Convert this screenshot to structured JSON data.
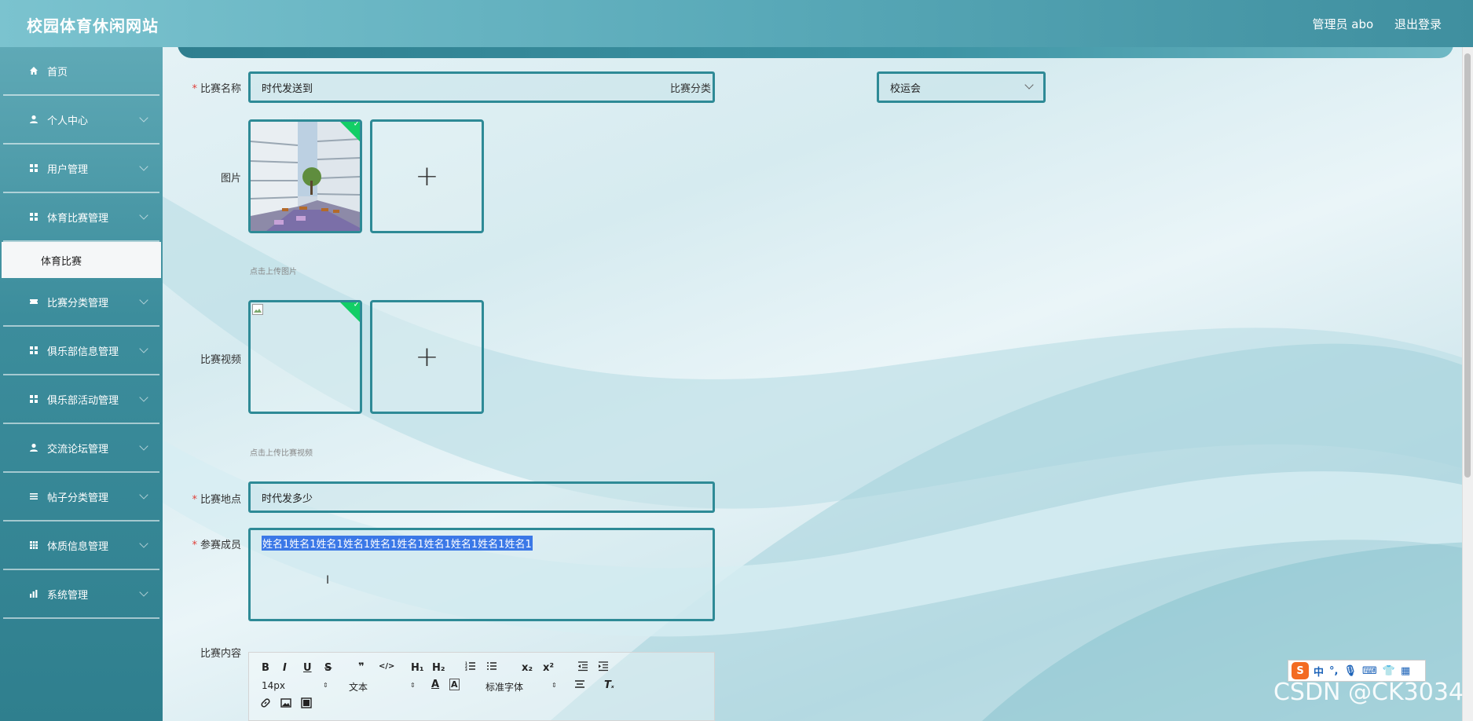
{
  "header": {
    "site_title": "校园体育休闲网站",
    "user_label": "管理员 abo",
    "logout": "退出登录"
  },
  "sidebar": {
    "items": [
      {
        "label": "首页",
        "icon": "home-icon",
        "has_arrow": false
      },
      {
        "label": "个人中心",
        "icon": "user-icon",
        "has_arrow": true
      },
      {
        "label": "用户管理",
        "icon": "grid-icon",
        "has_arrow": true
      },
      {
        "label": "体育比赛管理",
        "icon": "grid-icon",
        "has_arrow": true
      },
      {
        "label": "比赛分类管理",
        "icon": "ticket-icon",
        "has_arrow": true
      },
      {
        "label": "俱乐部信息管理",
        "icon": "grid-icon",
        "has_arrow": true
      },
      {
        "label": "俱乐部活动管理",
        "icon": "grid-icon",
        "has_arrow": true
      },
      {
        "label": "交流论坛管理",
        "icon": "user-icon",
        "has_arrow": true
      },
      {
        "label": "帖子分类管理",
        "icon": "list-icon",
        "has_arrow": true
      },
      {
        "label": "体质信息管理",
        "icon": "table-icon",
        "has_arrow": true
      },
      {
        "label": "系统管理",
        "icon": "bar-chart-icon",
        "has_arrow": true
      }
    ],
    "active_sub": "体育比赛"
  },
  "form": {
    "name_label": "比赛名称",
    "name_value": "时代发送到",
    "category_label": "比赛分类",
    "category_value": "校运会",
    "image_label": "图片",
    "image_hint": "点击上传图片",
    "video_label": "比赛视频",
    "video_hint": "点击上传比赛视频",
    "location_label": "比赛地点",
    "location_value": "时代发多少",
    "members_label": "参赛成员",
    "members_value": "姓名1姓名1姓名1姓名1姓名1姓名1姓名1姓名1姓名1姓名1",
    "content_label": "比赛内容",
    "upload_plus": "+",
    "check_mark": "✓"
  },
  "editor": {
    "bold": "B",
    "italic": "I",
    "underline": "U",
    "strike": "S",
    "quote": "❞",
    "code": "</>",
    "h1": "H₁",
    "h2": "H₂",
    "sub": "x₂",
    "sup": "x²",
    "font_size": "14px",
    "text_type": "文本",
    "font_family": "标准字体"
  },
  "ime": {
    "logo": "S",
    "lang": "中",
    "punct": "°,"
  },
  "watermark": "CSDN @CK3034"
}
